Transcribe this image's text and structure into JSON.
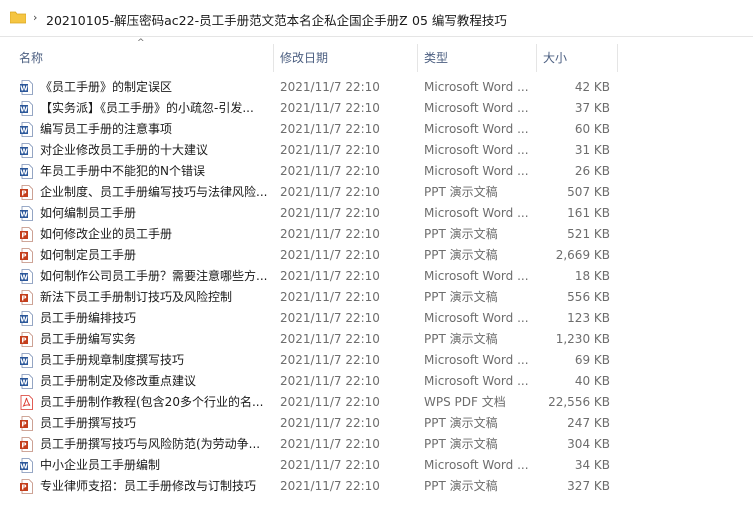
{
  "breadcrumb": {
    "items": [
      "20210105-解压密码ac22-员工手册范文范本名企私企国企手册Z",
      "05 编写教程技巧"
    ]
  },
  "columns": {
    "name": "名称",
    "date": "修改日期",
    "type": "类型",
    "size": "大小"
  },
  "files": [
    {
      "name": "《员工手册》的制定误区",
      "date": "2021/11/7 22:10",
      "type": "Microsoft Word ...",
      "size": "42 KB",
      "icon": "word-icon"
    },
    {
      "name": "【实务派】《员工手册》的小疏忽-引发...",
      "date": "2021/11/7 22:10",
      "type": "Microsoft Word ...",
      "size": "37 KB",
      "icon": "word-icon"
    },
    {
      "name": "编写员工手册的注意事项",
      "date": "2021/11/7 22:10",
      "type": "Microsoft Word ...",
      "size": "60 KB",
      "icon": "word-icon"
    },
    {
      "name": "对企业修改员工手册的十大建议",
      "date": "2021/11/7 22:10",
      "type": "Microsoft Word ...",
      "size": "31 KB",
      "icon": "word-icon"
    },
    {
      "name": "年员工手册中不能犯的N个错误",
      "date": "2021/11/7 22:10",
      "type": "Microsoft Word ...",
      "size": "26 KB",
      "icon": "word-icon"
    },
    {
      "name": "企业制度、员工手册编写技巧与法律风险...",
      "date": "2021/11/7 22:10",
      "type": "PPT 演示文稿",
      "size": "507 KB",
      "icon": "ppt-icon"
    },
    {
      "name": "如何编制员工手册",
      "date": "2021/11/7 22:10",
      "type": "Microsoft Word ...",
      "size": "161 KB",
      "icon": "word-icon"
    },
    {
      "name": "如何修改企业的员工手册",
      "date": "2021/11/7 22:10",
      "type": "PPT 演示文稿",
      "size": "521 KB",
      "icon": "ppt-icon"
    },
    {
      "name": "如何制定员工手册",
      "date": "2021/11/7 22:10",
      "type": "PPT 演示文稿",
      "size": "2,669 KB",
      "icon": "ppt-icon"
    },
    {
      "name": "如何制作公司员工手册？需要注意哪些方...",
      "date": "2021/11/7 22:10",
      "type": "Microsoft Word ...",
      "size": "18 KB",
      "icon": "word-icon"
    },
    {
      "name": "新法下员工手册制订技巧及风险控制",
      "date": "2021/11/7 22:10",
      "type": "PPT 演示文稿",
      "size": "556 KB",
      "icon": "ppt-icon"
    },
    {
      "name": "员工手册编排技巧",
      "date": "2021/11/7 22:10",
      "type": "Microsoft Word ...",
      "size": "123 KB",
      "icon": "word-icon"
    },
    {
      "name": "员工手册编写实务",
      "date": "2021/11/7 22:10",
      "type": "PPT 演示文稿",
      "size": "1,230 KB",
      "icon": "ppt-icon"
    },
    {
      "name": "员工手册规章制度撰写技巧",
      "date": "2021/11/7 22:10",
      "type": "Microsoft Word ...",
      "size": "69 KB",
      "icon": "word-icon"
    },
    {
      "name": "员工手册制定及修改重点建议",
      "date": "2021/11/7 22:10",
      "type": "Microsoft Word ...",
      "size": "40 KB",
      "icon": "word-icon"
    },
    {
      "name": "员工手册制作教程(包含20多个行业的名...",
      "date": "2021/11/7 22:10",
      "type": "WPS PDF 文档",
      "size": "22,556 KB",
      "icon": "pdf-icon"
    },
    {
      "name": "员工手册撰写技巧",
      "date": "2021/11/7 22:10",
      "type": "PPT 演示文稿",
      "size": "247 KB",
      "icon": "ppt-icon"
    },
    {
      "name": "员工手册撰写技巧与风险防范(为劳动争...",
      "date": "2021/11/7 22:10",
      "type": "PPT 演示文稿",
      "size": "304 KB",
      "icon": "ppt-icon"
    },
    {
      "name": "中小企业员工手册编制",
      "date": "2021/11/7 22:10",
      "type": "Microsoft Word ...",
      "size": "34 KB",
      "icon": "word-icon"
    },
    {
      "name": "专业律师支招：员工手册修改与订制技巧",
      "date": "2021/11/7 22:10",
      "type": "PPT 演示文稿",
      "size": "327 KB",
      "icon": "ppt-icon"
    }
  ],
  "colors": {
    "header_text": "#4d6082",
    "word": "#2b579a",
    "ppt": "#c43e1c",
    "pdf": "#d9342b",
    "folder": "#f5c542"
  }
}
